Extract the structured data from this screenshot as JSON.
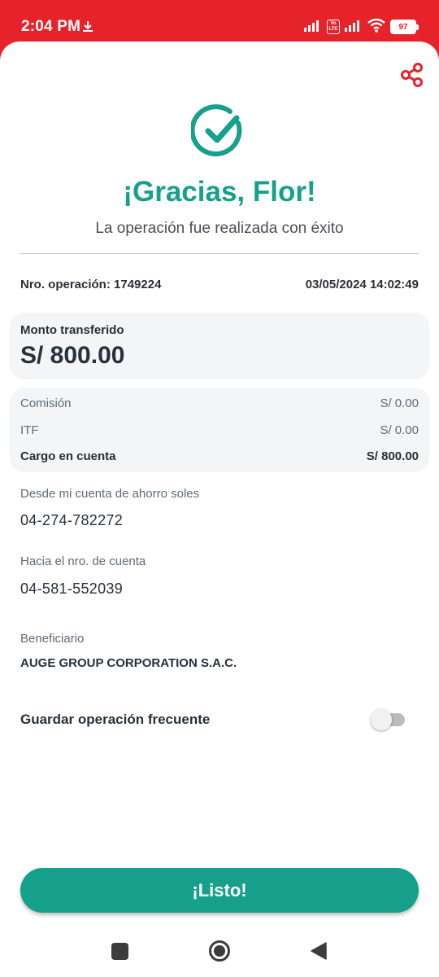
{
  "status_bar": {
    "time": "2:04 PM",
    "battery": "97",
    "volte": "Vo LTE"
  },
  "header": {
    "title": "¡Gracias, Flor!",
    "subtitle": "La operación fue realizada con éxito"
  },
  "operation": {
    "number_label": "Nro. operación: 1749224",
    "datetime": "03/05/2024 14:02:49"
  },
  "amount": {
    "label": "Monto transferido",
    "value": "S/ 800.00"
  },
  "fees": {
    "commission_label": "Comisión",
    "commission_value": "S/ 0.00",
    "itf_label": "ITF",
    "itf_value": "S/ 0.00",
    "charge_label": "Cargo en cuenta",
    "charge_value": "S/ 800.00"
  },
  "from_account": {
    "label": "Desde mi cuenta de ahorro soles",
    "value": "04-274-782272"
  },
  "to_account": {
    "label": "Hacia el nro. de cuenta",
    "value": "04-581-552039"
  },
  "beneficiary": {
    "label": "Beneficiario",
    "value": "AUGE GROUP CORPORATION S.A.C."
  },
  "frequent": {
    "label": "Guardar operación frecuente",
    "enabled": false
  },
  "actions": {
    "done_label": "¡Listo!"
  },
  "colors": {
    "brand_red": "#e6222a",
    "accent_green": "#17a08c"
  },
  "icons": {
    "download": "download-icon",
    "signal": "signal-icon",
    "wifi": "wifi-icon",
    "share": "share-icon",
    "success": "check-circle-icon"
  }
}
